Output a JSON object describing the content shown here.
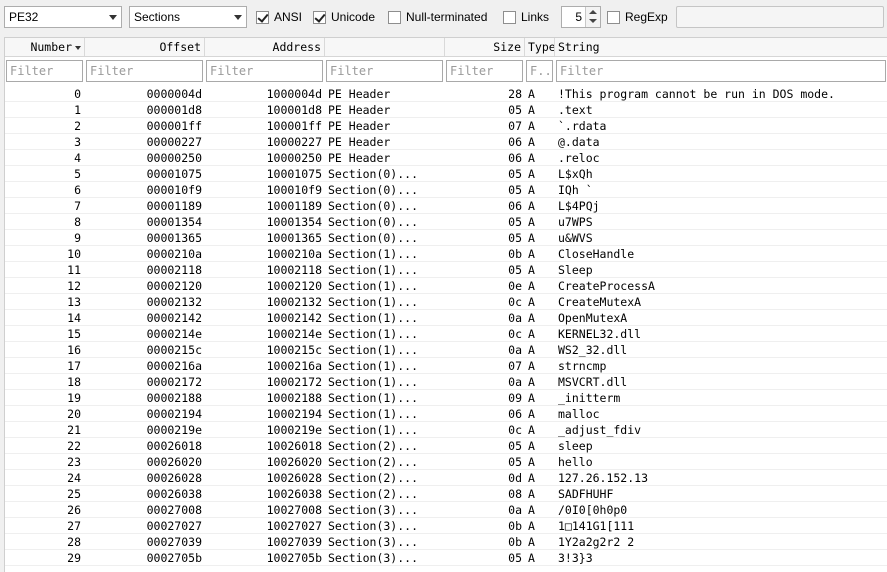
{
  "toolbar": {
    "file_type": "PE32",
    "region": "Sections",
    "ansi_label": "ANSI",
    "unicode_label": "Unicode",
    "null_terminated_label": "Null-terminated",
    "links_label": "Links",
    "min_length": "5",
    "regexp_label": "RegExp",
    "search_value": ""
  },
  "columns": [
    "Number",
    "Offset",
    "Address",
    "",
    "Size",
    "Type",
    "String"
  ],
  "filters": [
    "Filter",
    "Filter",
    "Filter",
    "Filter",
    "Filter",
    "F...",
    "Filter"
  ],
  "rows": [
    [
      "0",
      "0000004d",
      "1000004d",
      "PE Header",
      "28",
      "A",
      "!This program cannot be run in DOS mode."
    ],
    [
      "1",
      "000001d8",
      "100001d8",
      "PE Header",
      "05",
      "A",
      ".text"
    ],
    [
      "2",
      "000001ff",
      "100001ff",
      "PE Header",
      "07",
      "A",
      "`.rdata"
    ],
    [
      "3",
      "00000227",
      "10000227",
      "PE Header",
      "06",
      "A",
      "@.data"
    ],
    [
      "4",
      "00000250",
      "10000250",
      "PE Header",
      "06",
      "A",
      ".reloc"
    ],
    [
      "5",
      "00001075",
      "10001075",
      "Section(0)...",
      "05",
      "A",
      "L$xQh"
    ],
    [
      "6",
      "000010f9",
      "100010f9",
      "Section(0)...",
      "05",
      "A",
      "IQh `"
    ],
    [
      "7",
      "00001189",
      "10001189",
      "Section(0)...",
      "06",
      "A",
      "L$4PQj"
    ],
    [
      "8",
      "00001354",
      "10001354",
      "Section(0)...",
      "05",
      "A",
      "u7WPS"
    ],
    [
      "9",
      "00001365",
      "10001365",
      "Section(0)...",
      "05",
      "A",
      "u&WVS"
    ],
    [
      "10",
      "0000210a",
      "1000210a",
      "Section(1)...",
      "0b",
      "A",
      "CloseHandle"
    ],
    [
      "11",
      "00002118",
      "10002118",
      "Section(1)...",
      "05",
      "A",
      "Sleep"
    ],
    [
      "12",
      "00002120",
      "10002120",
      "Section(1)...",
      "0e",
      "A",
      "CreateProcessA"
    ],
    [
      "13",
      "00002132",
      "10002132",
      "Section(1)...",
      "0c",
      "A",
      "CreateMutexA"
    ],
    [
      "14",
      "00002142",
      "10002142",
      "Section(1)...",
      "0a",
      "A",
      "OpenMutexA"
    ],
    [
      "15",
      "0000214e",
      "1000214e",
      "Section(1)...",
      "0c",
      "A",
      "KERNEL32.dll"
    ],
    [
      "16",
      "0000215c",
      "1000215c",
      "Section(1)...",
      "0a",
      "A",
      "WS2_32.dll"
    ],
    [
      "17",
      "0000216a",
      "1000216a",
      "Section(1)...",
      "07",
      "A",
      "strncmp"
    ],
    [
      "18",
      "00002172",
      "10002172",
      "Section(1)...",
      "0a",
      "A",
      "MSVCRT.dll"
    ],
    [
      "19",
      "00002188",
      "10002188",
      "Section(1)...",
      "09",
      "A",
      "_initterm"
    ],
    [
      "20",
      "00002194",
      "10002194",
      "Section(1)...",
      "06",
      "A",
      "malloc"
    ],
    [
      "21",
      "0000219e",
      "1000219e",
      "Section(1)...",
      "0c",
      "A",
      "_adjust_fdiv"
    ],
    [
      "22",
      "00026018",
      "10026018",
      "Section(2)...",
      "05",
      "A",
      "sleep"
    ],
    [
      "23",
      "00026020",
      "10026020",
      "Section(2)...",
      "05",
      "A",
      "hello"
    ],
    [
      "24",
      "00026028",
      "10026028",
      "Section(2)...",
      "0d",
      "A",
      "127.26.152.13"
    ],
    [
      "25",
      "00026038",
      "10026038",
      "Section(2)...",
      "08",
      "A",
      "SADFHUHF"
    ],
    [
      "26",
      "00027008",
      "10027008",
      "Section(3)...",
      "0a",
      "A",
      "/0I0[0h0p0"
    ],
    [
      "27",
      "00027027",
      "10027027",
      "Section(3)...",
      "0b",
      "A",
      "1□141G1[111"
    ],
    [
      "28",
      "00027039",
      "10027039",
      "Section(3)...",
      "0b",
      "A",
      "1Y2a2g2r2 2"
    ],
    [
      "29",
      "0002705b",
      "1002705b",
      "Section(3)...",
      "05",
      "A",
      "3!3}3"
    ]
  ]
}
